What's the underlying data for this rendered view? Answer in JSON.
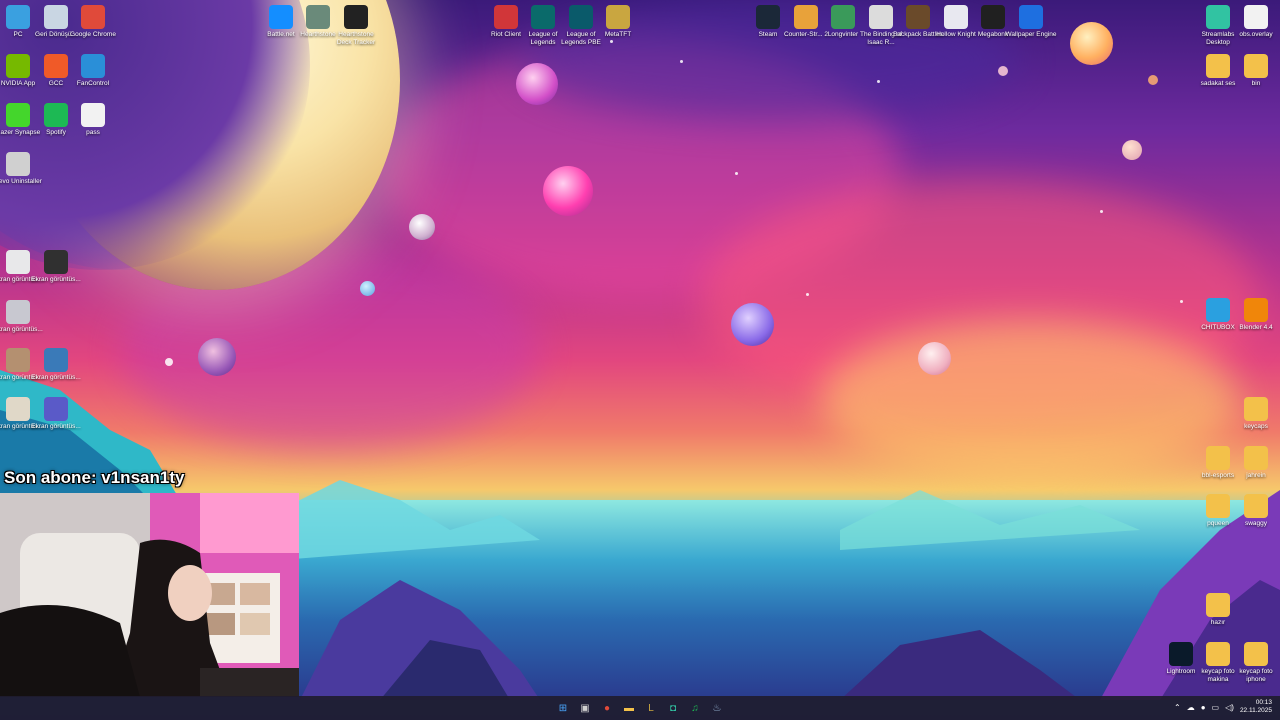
{
  "desktop": {
    "left_col": [
      {
        "label": "PC",
        "icon": "monitor-icon",
        "color": "#3aa0e0"
      },
      {
        "label": "Geri Dönüşü...",
        "icon": "recycle-bin-icon",
        "color": "#c9d6e3"
      },
      {
        "label": "Google Chrome",
        "icon": "chrome-icon",
        "color": "#e04a3a"
      },
      {
        "label": "NVIDIA App",
        "icon": "nvidia-icon",
        "color": "#76b900"
      },
      {
        "label": "GCC",
        "icon": "gcc-icon",
        "color": "#f05a28"
      },
      {
        "label": "FanControl",
        "icon": "fan-icon",
        "color": "#2a8fd8"
      },
      {
        "label": "Razer Synapse",
        "icon": "razer-icon",
        "color": "#44d62c"
      },
      {
        "label": "Spotify",
        "icon": "spotify-icon",
        "color": "#1db954"
      },
      {
        "label": "pass",
        "icon": "file-icon",
        "color": "#f2f2f2"
      },
      {
        "label": "Revo Uninstaller",
        "icon": "revo-icon",
        "color": "#d0d0d0"
      },
      {
        "label": "Ekran görüntüs...",
        "icon": "image-file-icon",
        "color": "#e8e8ea"
      },
      {
        "label": "Ekran görüntüs...",
        "icon": "image-file-icon",
        "color": "#303030"
      },
      {
        "label": "Ekran görüntüs...",
        "icon": "image-file-icon",
        "color": "#c8c8d0"
      },
      {
        "label": "Ekran görüntüs...",
        "icon": "image-file-icon",
        "color": "#b49070"
      },
      {
        "label": "Ekran görüntüs...",
        "icon": "image-file-icon",
        "color": "#3a7ab8"
      },
      {
        "label": "Ekran görüntüs...",
        "icon": "image-file-icon",
        "color": "#e0d8c8"
      },
      {
        "label": "Ekran görüntüs...",
        "icon": "image-file-icon",
        "color": "#5a5ac8"
      }
    ],
    "top_row": [
      {
        "label": "Battle.net",
        "icon": "battlenet-icon",
        "color": "#148eff"
      },
      {
        "label": "Hearthstone",
        "icon": "hearthstone-icon",
        "color": "#6a8a7a"
      },
      {
        "label": "Hearthstone Deck Tracker",
        "icon": "deck-tracker-icon",
        "color": "#222222"
      },
      {
        "label": "Riot Client",
        "icon": "riot-icon",
        "color": "#d13639"
      },
      {
        "label": "League of Legends",
        "icon": "league-icon",
        "color": "#0a6a6a"
      },
      {
        "label": "League of Legends PBE",
        "icon": "league-pbe-icon",
        "color": "#0a5a6a"
      },
      {
        "label": "MetaTFT",
        "icon": "metatft-icon",
        "color": "#c9a640"
      },
      {
        "label": "Steam",
        "icon": "steam-icon",
        "color": "#1b2838"
      },
      {
        "label": "Counter-Str... 2",
        "icon": "cs2-icon",
        "color": "#e8a23a"
      },
      {
        "label": "Longvinter",
        "icon": "longvinter-icon",
        "color": "#3a9a5a"
      },
      {
        "label": "The Binding of Isaac R...",
        "icon": "isaac-icon",
        "color": "#dcdcdc"
      },
      {
        "label": "Backpack Battles",
        "icon": "backpack-icon",
        "color": "#6a4a2a"
      },
      {
        "label": "Hollow Knight",
        "icon": "hollow-knight-icon",
        "color": "#e8e8f0"
      },
      {
        "label": "Megabonk",
        "icon": "megabonk-icon",
        "color": "#202020"
      },
      {
        "label": "Wallpaper Engine",
        "icon": "wallpaper-engine-icon",
        "color": "#1e6fe0"
      }
    ],
    "right_col": [
      {
        "label": "Streamlabs Desktop",
        "icon": "streamlabs-icon",
        "color": "#31c3a2"
      },
      {
        "label": "obs.overlay",
        "icon": "file-icon",
        "color": "#f2f2f2"
      },
      {
        "label": "sadakat ses",
        "icon": "folder-icon",
        "color": "#f3c14a"
      },
      {
        "label": "bin",
        "icon": "folder-icon",
        "color": "#f3c14a"
      },
      {
        "label": "CHITUBOX",
        "icon": "chitubox-icon",
        "color": "#2aa0e0"
      },
      {
        "label": "Blender 4.4",
        "icon": "blender-icon",
        "color": "#f0860a"
      },
      {
        "label": "keycaps",
        "icon": "folder-icon",
        "color": "#f3c14a"
      },
      {
        "label": "bbl-esports",
        "icon": "folder-icon",
        "color": "#f3c14a"
      },
      {
        "label": "jahrein",
        "icon": "folder-icon",
        "color": "#f3c14a"
      },
      {
        "label": "pqueen",
        "icon": "folder-icon",
        "color": "#f3c14a"
      },
      {
        "label": "swaggy",
        "icon": "folder-icon",
        "color": "#f3c14a"
      },
      {
        "label": "hazır",
        "icon": "folder-icon",
        "color": "#f3c14a"
      },
      {
        "label": "Lightroom",
        "icon": "lightroom-icon",
        "color": "#0a1a2a"
      },
      {
        "label": "keycap foto makina",
        "icon": "folder-icon",
        "color": "#f3c14a"
      },
      {
        "label": "keycap foto iphone",
        "icon": "folder-icon",
        "color": "#f3c14a"
      }
    ]
  },
  "overlay": {
    "subscriber_text": "Son abone: v1nsan1ty"
  },
  "taskbar": {
    "apps": [
      {
        "name": "start-button",
        "glyph": "⊞",
        "color": "#4aa8ff"
      },
      {
        "name": "task-view-button",
        "glyph": "▣",
        "color": "#d0d0d0"
      },
      {
        "name": "chrome-taskbar",
        "glyph": "●",
        "color": "#e04a3a"
      },
      {
        "name": "explorer-taskbar",
        "glyph": "▬",
        "color": "#f3c14a"
      },
      {
        "name": "league-taskbar",
        "glyph": "L",
        "color": "#c9a640"
      },
      {
        "name": "streamlabs-taskbar",
        "glyph": "◘",
        "color": "#31c3a2"
      },
      {
        "name": "spotify-taskbar",
        "glyph": "♫",
        "color": "#1db954"
      },
      {
        "name": "steam-taskbar",
        "glyph": "♨",
        "color": "#9ab8d8"
      }
    ],
    "time": "00:13",
    "date": "22.11.2025"
  }
}
